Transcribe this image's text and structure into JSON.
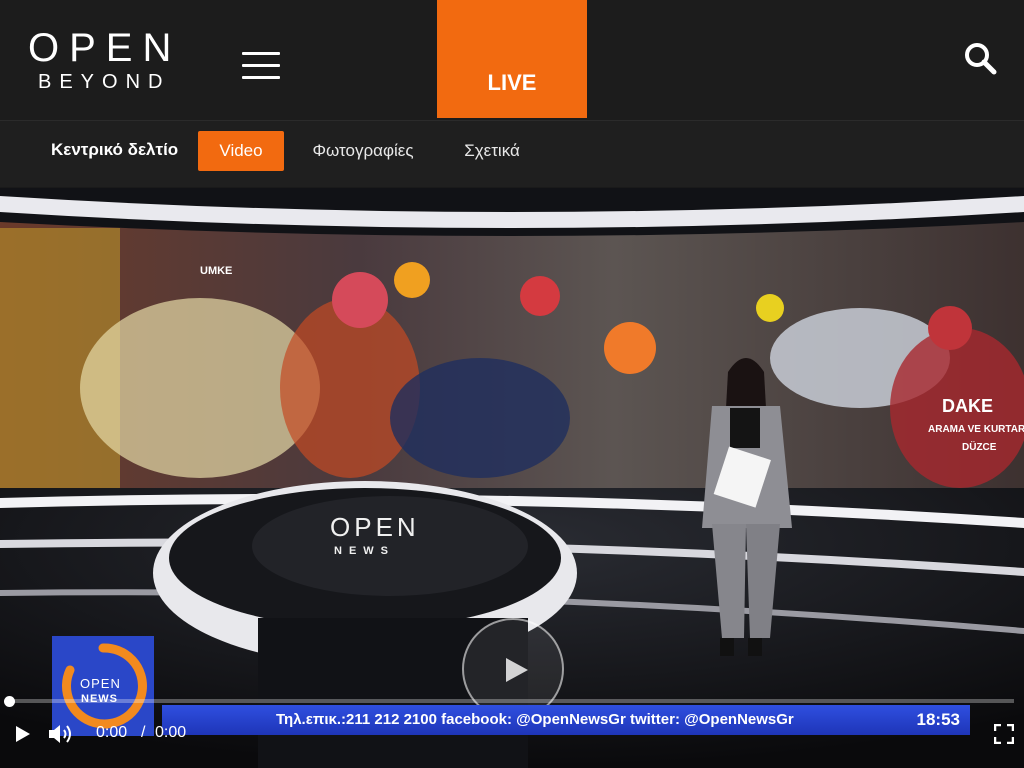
{
  "header": {
    "logo_top": "OPEN",
    "logo_bottom": "BEYOND",
    "live_label": "LIVE",
    "icons": {
      "menu": "hamburger-icon",
      "search": "search-icon"
    }
  },
  "subnav": {
    "title": "Κεντρικό δελτίο",
    "tabs": [
      {
        "label": "Video",
        "active": true
      },
      {
        "label": "Φωτογραφίες",
        "active": false
      },
      {
        "label": "Σχετικά",
        "active": false
      }
    ]
  },
  "video": {
    "studio_logo_top": "OPEN",
    "studio_logo_bottom": "NEWS",
    "screen_texts": [
      "UMKE",
      "DAKE",
      "ARAMA VE KURTAR",
      "DÜZCE"
    ],
    "channel_logo": "OPEN NEWS",
    "ticker": "Τηλ.επικ.:211 212 2100 facebook: @OpenNewsGr twitter: @OpenNewsGr",
    "clock": "18:53",
    "progress": 0
  },
  "controls": {
    "current_time": "0:00",
    "separator": "/",
    "duration": "0:00",
    "icons": {
      "play": "play-icon",
      "volume": "volume-icon",
      "fullscreen": "fullscreen-icon",
      "overlay": "play-circle-icon"
    }
  },
  "colors": {
    "accent": "#f26a10",
    "header_bg": "#1c1c1c",
    "ticker_bg": "#2f4fe0"
  }
}
